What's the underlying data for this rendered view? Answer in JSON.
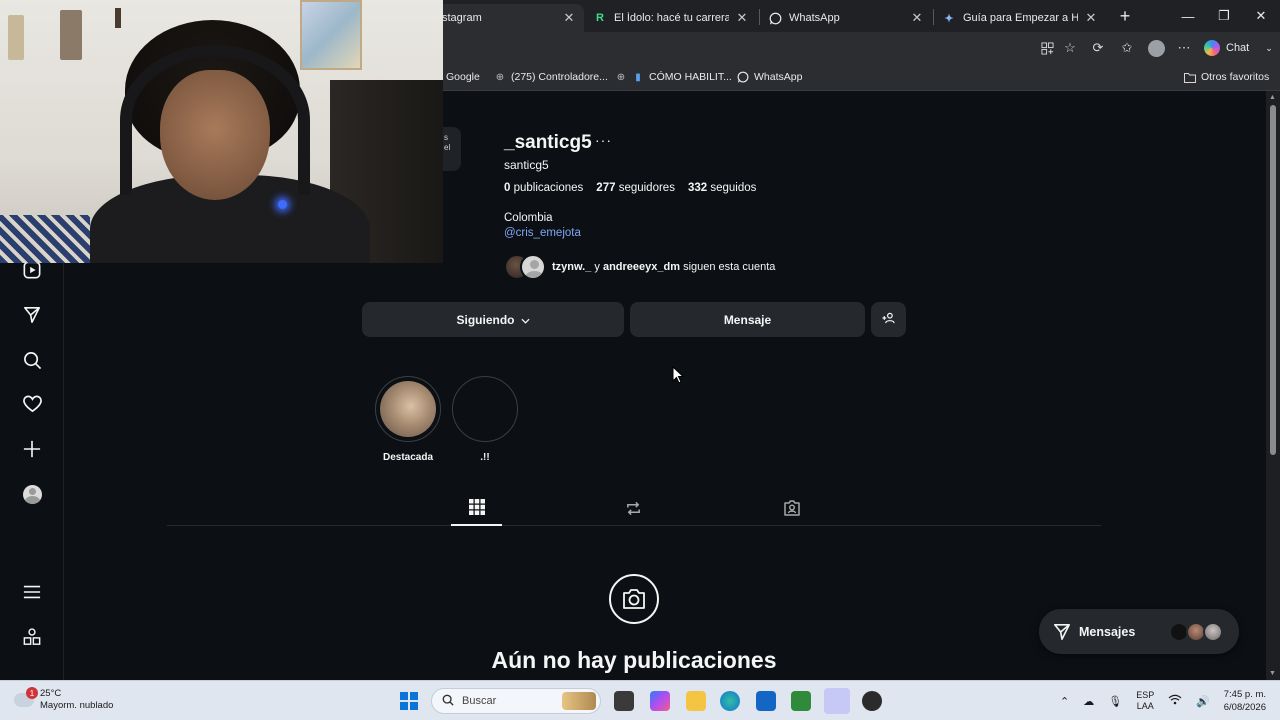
{
  "browser": {
    "tabs": [
      {
        "title": "stagram",
        "active": true
      },
      {
        "title": "El Ídolo: hacé tu carrera en la l",
        "active": false
      },
      {
        "title": "WhatsApp",
        "active": false
      },
      {
        "title": "Guía para Empezar a Hacer St",
        "active": false
      }
    ],
    "chat_label": "Chat",
    "bookmarks": [
      {
        "label": "Google"
      },
      {
        "label": "(275) Controladore..."
      },
      {
        "label": "CÓMO HABILIT..."
      },
      {
        "label": "WhatsApp"
      }
    ],
    "other_favorites": "Otros favoritos"
  },
  "peek_card_text": "s\nel",
  "profile": {
    "username": "_santicg5",
    "more": "···",
    "full_name": "santicg5",
    "posts_count": "0",
    "posts_label": "publicaciones",
    "followers_count": "277",
    "followers_label": "seguidores",
    "following_count": "332",
    "following_label": "seguidos",
    "location": "Colombia",
    "bio_link": "@cris_emejota",
    "followed_by_user1": "tzynw._",
    "followed_by_and": "y",
    "followed_by_user2": "andreeeyx_dm",
    "followed_by_suffix": "siguen esta cuenta",
    "following_button": "Siguiendo",
    "message_button": "Mensaje"
  },
  "highlights": [
    {
      "label": "Destacada"
    },
    {
      "label": ".!!"
    }
  ],
  "empty_state": {
    "title": "Aún no hay publicaciones"
  },
  "messages_pill": {
    "label": "Mensajes"
  },
  "taskbar": {
    "weather_temp": "25°C",
    "weather_desc": "Mayorm. nublado",
    "weather_badge": "1",
    "search_placeholder": "Buscar",
    "lang_top": "ESP",
    "lang_bottom": "LAA",
    "time": "7:45 p. m.",
    "date": "6/08/2026"
  },
  "colors": {
    "page_bg": "#0c1014",
    "button_bg": "#25292e",
    "link": "#7ea6f4",
    "taskbar_bg": "#dfe6ef"
  }
}
